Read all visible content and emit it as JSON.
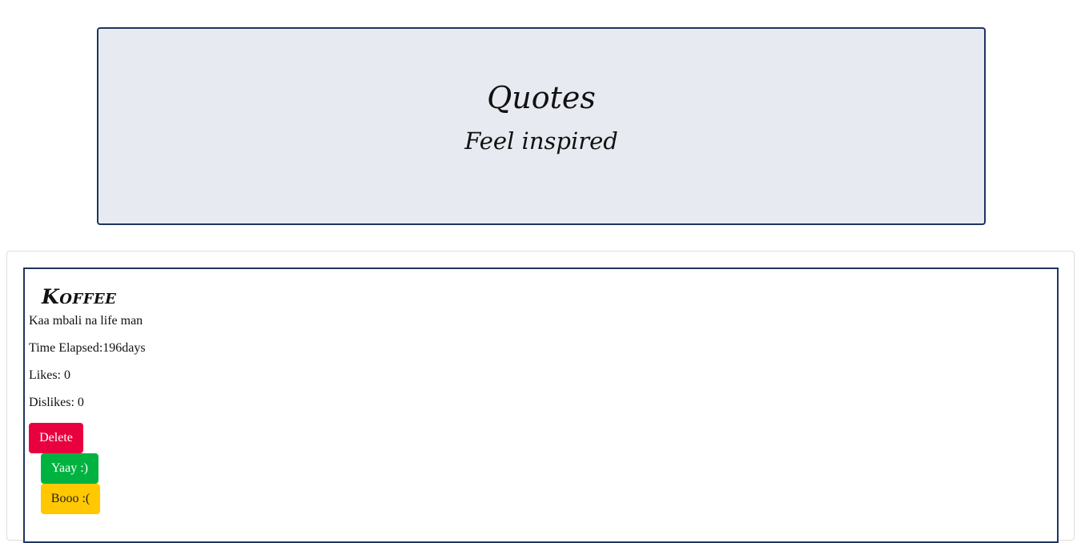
{
  "header": {
    "title": "Quotes",
    "subtitle": "Feel inspired"
  },
  "quote": {
    "author": "Koffee",
    "text": "Kaa mbali na life man",
    "elapsed": "Time Elapsed:196days",
    "likes": "Likes: 0",
    "dislikes": "Dislikes: 0",
    "delete_label": "Delete",
    "upvote_label": "Yaay :)",
    "downvote_label": "Booo :("
  },
  "colors": {
    "header_bg": "#e7eaf0",
    "border_accent": "#1f3560",
    "delete": "#e8003f",
    "upvote": "#00b341",
    "downvote": "#ffc800"
  }
}
